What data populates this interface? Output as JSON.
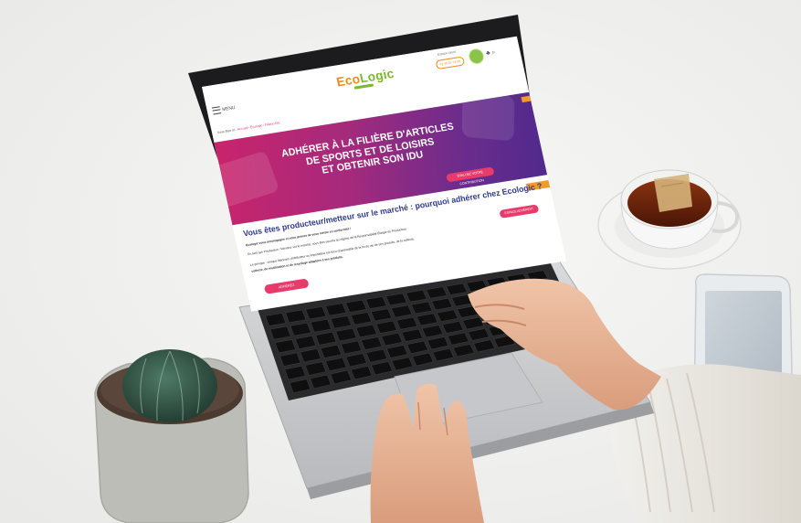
{
  "site": {
    "logo_main": "Eco",
    "logo_accent": "Logic",
    "menu_label": "MENU",
    "header_info": "Espace client",
    "header_pill": "01 30 57 79 09",
    "search_icon": "search-icon",
    "user_icon": "user-icon",
    "breadcrumb_home": "Vous êtes ici :",
    "breadcrumb_path": "Accueil › Ecologic › Filière ASL",
    "hero_title_1": "ADHÉRER À LA FILIÈRE D'ARTICLES",
    "hero_title_2": "DE SPORTS ET DE LOISIRS",
    "hero_title_3": "ET OBTENIR SON IDU",
    "hero_button": "ÉVALUEZ VOTRE CONTRIBUTION",
    "section_title": "Vous êtes producteur/metteur sur le marché : pourquoi adhérer chez Ecologic ?",
    "line_1": "Ecologic vous accompagne et vous permet de vous mettre en conformité !",
    "line_2": "En tant que Producteur / Vendeur sur le marché, vous êtes soumis au régime de la Responsabilité Élargie du Producteur.",
    "line_3": "Le principe : chaque fabricant, distributeur ou importateur est tenu responsable de la fin de vie de ses produits, de la collecte,",
    "line_4": "collecte, de réutilisation et de recyclage adaptées à ses produits.",
    "space_button": "ESPACE ADHÉRENT",
    "join_button": "ADHÉREZ"
  },
  "colors": {
    "brand_orange": "#f08a1c",
    "brand_green": "#7cb82f",
    "brand_pink": "#e2336b",
    "title_blue": "#2e3a8c",
    "hero_start": "#c9246c",
    "hero_end": "#502a8c"
  },
  "scene_objects": [
    "laptop",
    "keyboard",
    "hands",
    "tea-cup",
    "saucer",
    "smartphone",
    "cactus-pot",
    "sweater-sleeve"
  ]
}
